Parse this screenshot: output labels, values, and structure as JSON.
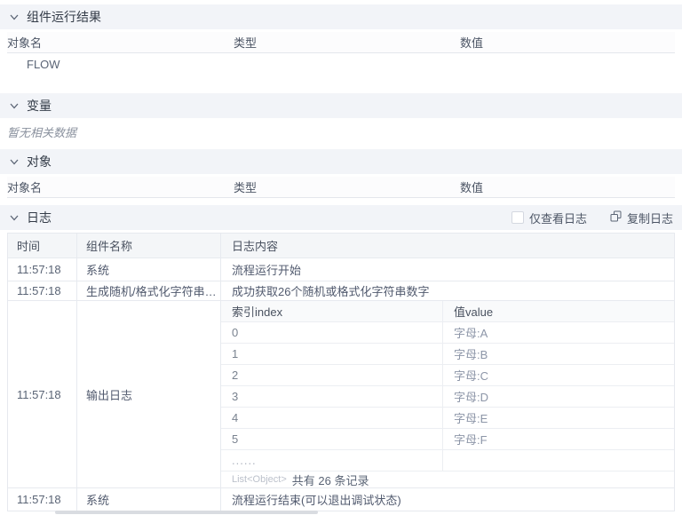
{
  "sections": {
    "component_result": {
      "title": "组件运行结果"
    },
    "variables": {
      "title": "变量",
      "empty_text": "暂无相关数据"
    },
    "objects": {
      "title": "对象"
    },
    "logs": {
      "title": "日志",
      "only_view_label": "仅查看日志",
      "copy_label": "复制日志"
    }
  },
  "result_table": {
    "headers": [
      "对象名",
      "类型",
      "数值"
    ],
    "rows": [
      {
        "name": "FLOW",
        "type": "",
        "value": ""
      }
    ]
  },
  "object_table": {
    "headers": [
      "对象名",
      "类型",
      "数值"
    ]
  },
  "log_table": {
    "headers": [
      "时间",
      "组件名称",
      "日志内容"
    ],
    "rows": [
      {
        "time": "11:57:18",
        "component": "系统",
        "content": "流程运行开始"
      },
      {
        "time": "11:57:18",
        "component": "生成随机/格式化字符串…",
        "content": "成功获取26个随机或格式化字符串数字"
      },
      {
        "time": "11:57:18",
        "component": "输出日志"
      },
      {
        "time": "11:57:18",
        "component": "系统",
        "content": "流程运行结束(可以退出调试状态)"
      }
    ]
  },
  "nested_table": {
    "headers": [
      "索引index",
      "值value"
    ],
    "rows": [
      [
        "0",
        "字母:A"
      ],
      [
        "1",
        "字母:B"
      ],
      [
        "2",
        "字母:C"
      ],
      [
        "3",
        "字母:D"
      ],
      [
        "4",
        "字母:E"
      ],
      [
        "5",
        "字母:F"
      ]
    ],
    "ellipsis": "......",
    "footer_type": "List<Object>",
    "footer_text": "共有 26 条记录"
  },
  "colors": {
    "section_bar_bg": "#f2f4f8",
    "table_border": "#e6e9ee",
    "muted_value": "#8d96a8",
    "type_tag": "#bcc1cb"
  }
}
